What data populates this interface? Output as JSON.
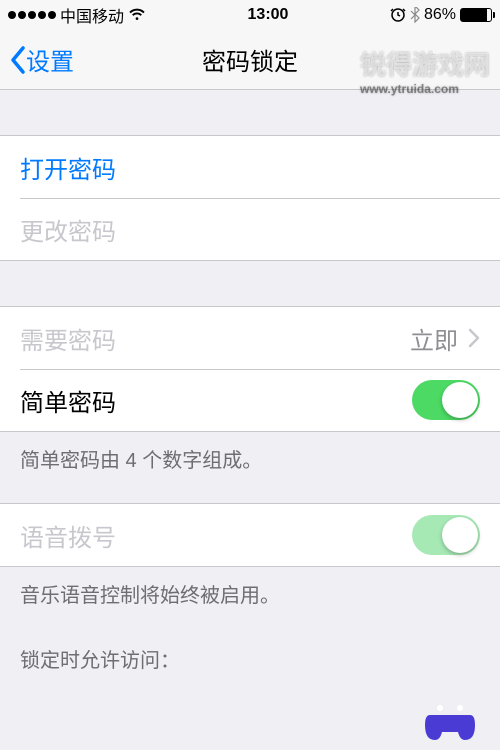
{
  "status": {
    "carrier": "中国移动",
    "time": "13:00",
    "battery_percent": "86%"
  },
  "nav": {
    "back_label": "设置",
    "title": "密码锁定"
  },
  "cells": {
    "turn_on_passcode": "打开密码",
    "change_passcode": "更改密码",
    "require_passcode": "需要密码",
    "require_value": "立即",
    "simple_passcode": "简单密码",
    "voice_dial": "语音拨号"
  },
  "footers": {
    "simple_passcode_hint": "简单密码由 4 个数字组成。",
    "voice_dial_hint": "音乐语音控制将始终被启用。",
    "allow_access_header": "锁定时允许访问："
  },
  "watermark": {
    "main": "锐得游戏网",
    "sub": "www.ytruida.com"
  }
}
